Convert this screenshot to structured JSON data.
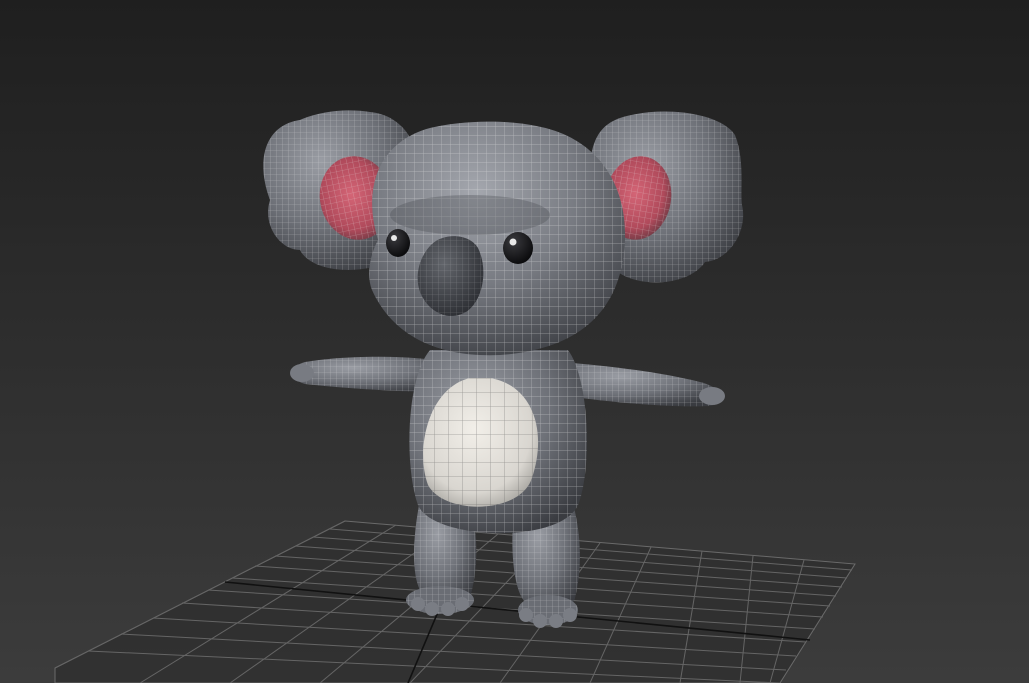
{
  "viewport": {
    "background_top": "#1f1f1f",
    "background_bottom": "#3c3c3c",
    "grid_color": "#6a6a6a",
    "grid_axis_color": "#111111"
  },
  "model": {
    "subject": "koala",
    "body_color": "#6e7178",
    "belly_color": "#e6e3dd",
    "inner_ear_color": "#c05060",
    "nose_color": "#3e4046",
    "wireframe_color": "#e8e8e8"
  }
}
